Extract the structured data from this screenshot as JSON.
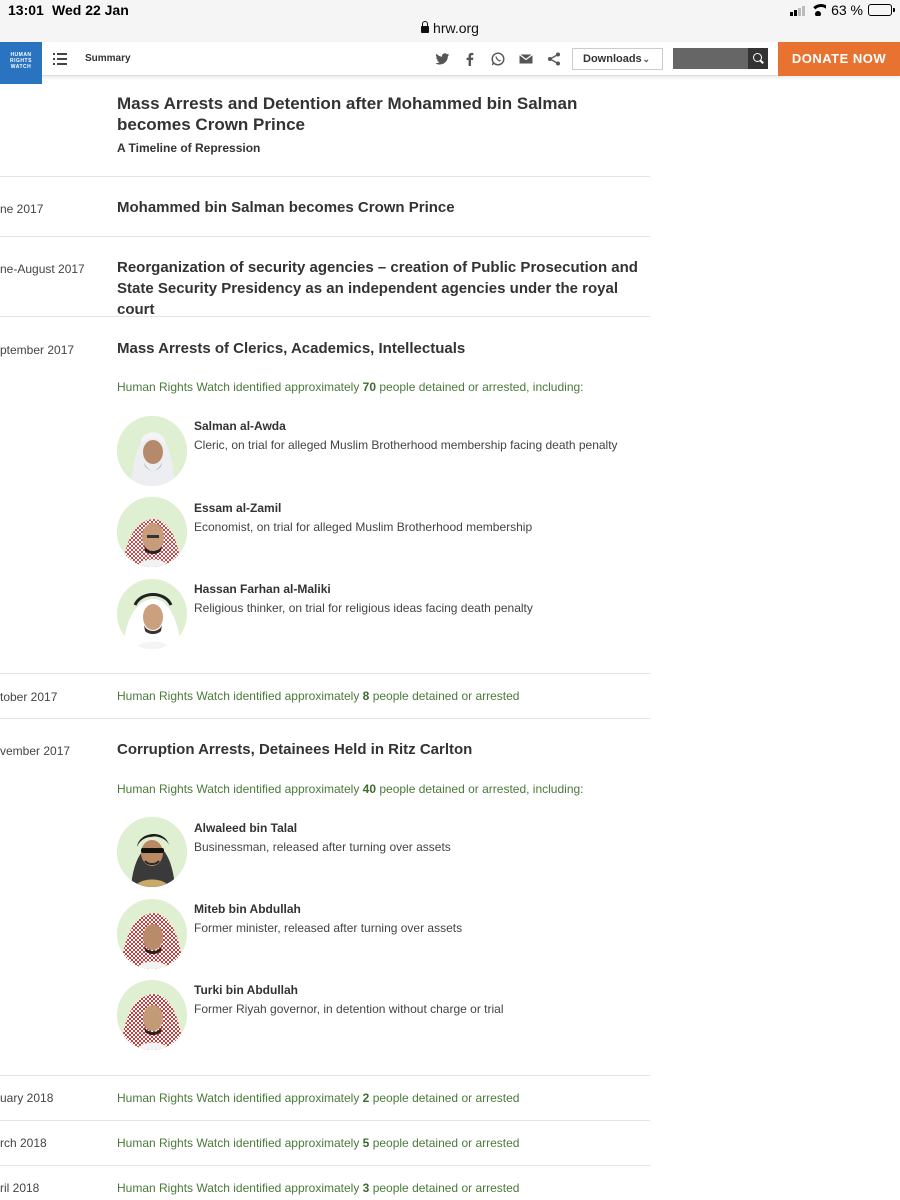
{
  "status_bar": {
    "time": "13:01",
    "date": "Wed 22 Jan",
    "battery": "63 %",
    "battery_fraction": 0.63
  },
  "browser": {
    "url": "hrw.org"
  },
  "toolbar": {
    "logo_text": "HUMAN RIGHTS WATCH",
    "summary_label": "Summary",
    "share_icons": [
      "twitter-icon",
      "facebook-icon",
      "whatsapp-icon",
      "email-icon",
      "share-icon"
    ],
    "downloads_label": "Downloads",
    "search_placeholder": "",
    "donate_label": "DONATE NOW",
    "colors": {
      "logo": "#2a73c0",
      "donate": "#e8722f",
      "count_text": "#4a7a3a"
    }
  },
  "page": {
    "title": "Mass Arrests and Detention after Mohammed bin Salman becomes Crown Prince",
    "subtitle": "A Timeline of Repression"
  },
  "timeline": [
    {
      "date": "ne 2017",
      "title": "Mohammed bin Salman becomes Crown Prince"
    },
    {
      "date": "ne-August 2017",
      "title": "Reorganization of security agencies – creation of Public Prosecution and State Security Presidency as an independent agencies under the royal court"
    },
    {
      "date": "ptember 2017",
      "title": "Mass Arrests of Clerics, Academics, Intellectuals",
      "count_prefix": "Human Rights Watch identified approximately ",
      "count": "70",
      "count_suffix": " people detained or arrested, including:",
      "people": [
        {
          "name": "Salman al-Awda",
          "desc": "Cleric, on trial for alleged Muslim Brotherhood membership facing death penalty"
        },
        {
          "name": "Essam al-Zamil",
          "desc": "Economist, on trial for alleged Muslim Brotherhood membership"
        },
        {
          "name": "Hassan Farhan al-Maliki",
          "desc": "Religious thinker, on trial for religious ideas facing death penalty"
        }
      ]
    },
    {
      "date": "tober 2017",
      "count_prefix": "Human Rights Watch identified approximately ",
      "count": "8",
      "count_suffix": " people detained or arrested"
    },
    {
      "date": "vember 2017",
      "title": "Corruption Arrests, Detainees Held in Ritz Carlton",
      "count_prefix": "Human Rights Watch identified approximately ",
      "count": "40",
      "count_suffix": " people detained or arrested, including:",
      "people": [
        {
          "name": "Alwaleed bin Talal",
          "desc": "Businessman, released after turning over assets"
        },
        {
          "name": "Miteb bin Abdullah",
          "desc": "Former minister, released after turning over assets"
        },
        {
          "name": "Turki bin Abdullah",
          "desc": "Former Riyah governor, in detention without charge or trial"
        }
      ]
    },
    {
      "date": "uary 2018",
      "count_prefix": "Human Rights Watch identified approximately ",
      "count": "2",
      "count_suffix": " people detained or arrested"
    },
    {
      "date": "rch 2018",
      "count_prefix": "Human Rights Watch identified approximately ",
      "count": "5",
      "count_suffix": " people detained or arrested"
    },
    {
      "date": "ril 2018",
      "count_prefix": "Human Rights Watch identified approximately ",
      "count": "3",
      "count_suffix": " people detained or arrested"
    }
  ]
}
